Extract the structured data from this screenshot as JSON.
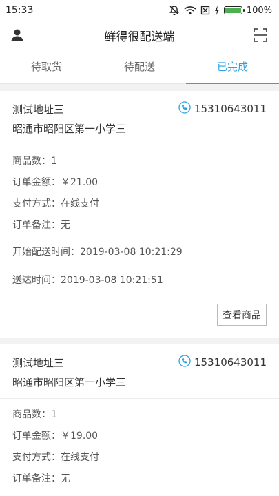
{
  "status_bar": {
    "time": "15:33",
    "battery_percent": "100%",
    "battery_level": 1.0,
    "icons": [
      "bell-muted-icon",
      "wifi-icon",
      "sim-icon",
      "charging-icon",
      "battery-icon"
    ]
  },
  "header": {
    "title": "鲜得很配送端",
    "left_icon": "user-icon",
    "right_icon": "scan-icon"
  },
  "tabs": [
    {
      "label": "待取货",
      "active": false
    },
    {
      "label": "待配送",
      "active": false
    },
    {
      "label": "已完成",
      "active": true
    }
  ],
  "colors": {
    "accent": "#2da3e0",
    "background": "#f2f2f2"
  },
  "orders": [
    {
      "address_name": "测试地址三",
      "phone": "15310643011",
      "address_detail": "昭通市昭阳区第一小学三",
      "item_count": "商品数：1",
      "amount": "订单金额：￥21.00",
      "payment": "支付方式：在线支付",
      "remark": "订单备注：无",
      "start_time": "开始配送时间：2019-03-08 10:21:29",
      "delivered_time": "送达时间：2019-03-08 10:21:51",
      "button": "查看商品"
    },
    {
      "address_name": "测试地址三",
      "phone": "15310643011",
      "address_detail": "昭通市昭阳区第一小学三",
      "item_count": "商品数：1",
      "amount": "订单金额：￥19.00",
      "payment": "支付方式：在线支付",
      "remark": "订单备注：无"
    }
  ]
}
